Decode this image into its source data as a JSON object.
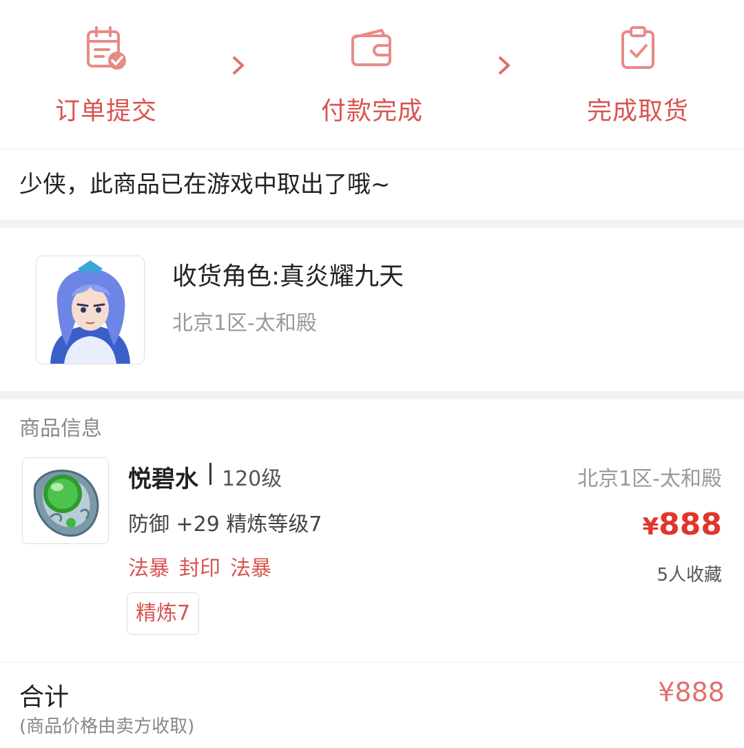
{
  "progress": {
    "steps": [
      {
        "label": "订单提交",
        "icon": "calendar-check-icon"
      },
      {
        "label": "付款完成",
        "icon": "wallet-icon"
      },
      {
        "label": "完成取货",
        "icon": "clipboard-check-icon"
      }
    ],
    "accent_color": "#d9534f"
  },
  "notice": {
    "text": "少侠，此商品已在游戏中取出了哦~"
  },
  "receiver": {
    "role_label": "收货角色:真炎耀九天",
    "server": "北京1区-太和殿",
    "avatar_icon": "character-avatar"
  },
  "goods": {
    "section_title": "商品信息",
    "item": {
      "name": "悦碧水",
      "level": "120级",
      "server": "北京1区-太和殿",
      "attr": "防御 +29 精炼等级7",
      "skills": [
        "法暴",
        "封印",
        "法暴"
      ],
      "currency": "¥",
      "price": "888",
      "favorites": "5人收藏",
      "tag": "精炼7",
      "image_icon": "jade-ring-icon"
    }
  },
  "total": {
    "label": "合计",
    "note": "(商品价格由卖方收取)",
    "price": "¥888"
  }
}
